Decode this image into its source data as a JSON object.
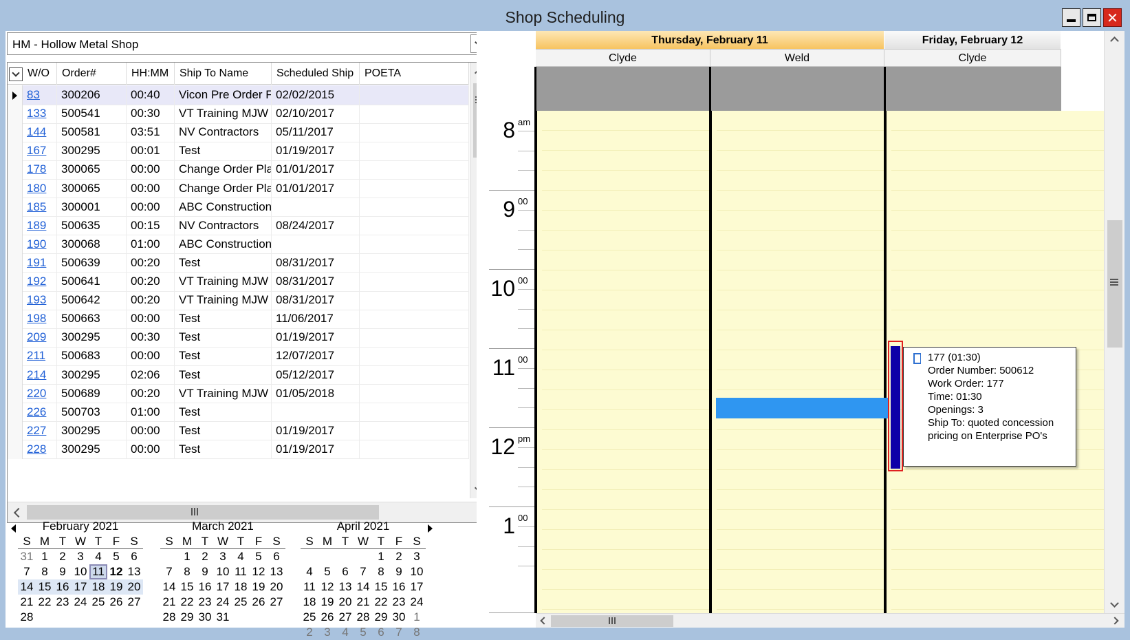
{
  "window": {
    "title": "Shop Scheduling"
  },
  "shop_selector": {
    "value": "HM - Hollow Metal Shop"
  },
  "grid": {
    "columns": [
      "W/O",
      "Order#",
      "HH:MM",
      "Ship To Name",
      "Scheduled Ship",
      "POETA"
    ],
    "rows": [
      {
        "wo": "83",
        "order": "300206",
        "time": "00:40",
        "ship_to": "Vicon Pre Order F",
        "sched": "02/02/2015",
        "poeta": ""
      },
      {
        "wo": "133",
        "order": "500541",
        "time": "00:30",
        "ship_to": "VT Training MJW",
        "sched": "02/10/2017",
        "poeta": ""
      },
      {
        "wo": "144",
        "order": "500581",
        "time": "03:51",
        "ship_to": "NV Contractors",
        "sched": "05/11/2017",
        "poeta": ""
      },
      {
        "wo": "167",
        "order": "300295",
        "time": "00:01",
        "ship_to": "Test",
        "sched": "01/19/2017",
        "poeta": ""
      },
      {
        "wo": "178",
        "order": "300065",
        "time": "00:00",
        "ship_to": "Change Order Pla",
        "sched": "01/01/2017",
        "poeta": ""
      },
      {
        "wo": "180",
        "order": "300065",
        "time": "00:00",
        "ship_to": "Change Order Pla",
        "sched": "01/01/2017",
        "poeta": ""
      },
      {
        "wo": "185",
        "order": "300001",
        "time": "00:00",
        "ship_to": "ABC Construction",
        "sched": "",
        "poeta": ""
      },
      {
        "wo": "189",
        "order": "500635",
        "time": "00:15",
        "ship_to": "NV Contractors",
        "sched": "08/24/2017",
        "poeta": ""
      },
      {
        "wo": "190",
        "order": "300068",
        "time": "01:00",
        "ship_to": "ABC Construction",
        "sched": "",
        "poeta": ""
      },
      {
        "wo": "191",
        "order": "500639",
        "time": "00:20",
        "ship_to": "Test",
        "sched": "08/31/2017",
        "poeta": ""
      },
      {
        "wo": "192",
        "order": "500641",
        "time": "00:20",
        "ship_to": "VT Training MJW",
        "sched": "08/31/2017",
        "poeta": ""
      },
      {
        "wo": "193",
        "order": "500642",
        "time": "00:20",
        "ship_to": "VT Training MJW",
        "sched": "08/31/2017",
        "poeta": ""
      },
      {
        "wo": "198",
        "order": "500663",
        "time": "00:00",
        "ship_to": "Test",
        "sched": "11/06/2017",
        "poeta": ""
      },
      {
        "wo": "209",
        "order": "300295",
        "time": "00:30",
        "ship_to": "Test",
        "sched": "01/19/2017",
        "poeta": ""
      },
      {
        "wo": "211",
        "order": "500683",
        "time": "00:00",
        "ship_to": "Test",
        "sched": "12/07/2017",
        "poeta": ""
      },
      {
        "wo": "214",
        "order": "300295",
        "time": "02:06",
        "ship_to": "Test",
        "sched": "05/12/2017",
        "poeta": ""
      },
      {
        "wo": "220",
        "order": "500689",
        "time": "00:20",
        "ship_to": "VT Training MJW",
        "sched": "01/05/2018",
        "poeta": ""
      },
      {
        "wo": "226",
        "order": "500703",
        "time": "01:00",
        "ship_to": "Test",
        "sched": "",
        "poeta": ""
      },
      {
        "wo": "227",
        "order": "300295",
        "time": "00:00",
        "ship_to": "Test",
        "sched": "01/19/2017",
        "poeta": ""
      },
      {
        "wo": "228",
        "order": "300295",
        "time": "00:00",
        "ship_to": "Test",
        "sched": "01/19/2017",
        "poeta": ""
      }
    ]
  },
  "calendars": [
    {
      "title": "February 2021",
      "dow": [
        "S",
        "M",
        "T",
        "W",
        "T",
        "F",
        "S"
      ],
      "weeks": [
        [
          "31",
          "1",
          "2",
          "3",
          "4",
          "5",
          "6"
        ],
        [
          "7",
          "8",
          "9",
          "10",
          "11",
          "12",
          "13"
        ],
        [
          "14",
          "15",
          "16",
          "17",
          "18",
          "19",
          "20"
        ],
        [
          "21",
          "22",
          "23",
          "24",
          "25",
          "26",
          "27"
        ],
        [
          "28"
        ]
      ]
    },
    {
      "title": "March 2021",
      "dow": [
        "S",
        "M",
        "T",
        "W",
        "T",
        "F",
        "S"
      ],
      "weeks": [
        [
          "",
          "1",
          "2",
          "3",
          "4",
          "5",
          "6"
        ],
        [
          "7",
          "8",
          "9",
          "10",
          "11",
          "12",
          "13"
        ],
        [
          "14",
          "15",
          "16",
          "17",
          "18",
          "19",
          "20"
        ],
        [
          "21",
          "22",
          "23",
          "24",
          "25",
          "26",
          "27"
        ],
        [
          "28",
          "29",
          "30",
          "31"
        ]
      ]
    },
    {
      "title": "April 2021",
      "dow": [
        "S",
        "M",
        "T",
        "W",
        "T",
        "F",
        "S"
      ],
      "weeks": [
        [
          "",
          "",
          "",
          "",
          "1",
          "2",
          "3"
        ],
        [
          "4",
          "5",
          "6",
          "7",
          "8",
          "9",
          "10"
        ],
        [
          "11",
          "12",
          "13",
          "14",
          "15",
          "16",
          "17"
        ],
        [
          "18",
          "19",
          "20",
          "21",
          "22",
          "23",
          "24"
        ],
        [
          "25",
          "26",
          "27",
          "28",
          "29",
          "30",
          "1"
        ],
        [
          "2",
          "3",
          "4",
          "5",
          "6",
          "7",
          "8"
        ]
      ]
    }
  ],
  "scheduler": {
    "days": [
      {
        "label": "Thursday, February 11",
        "resources": [
          "Clyde",
          "Weld"
        ]
      },
      {
        "label": "Friday, February 12",
        "resources": [
          "Clyde"
        ]
      }
    ],
    "hours": [
      {
        "num": "8",
        "sub": "am"
      },
      {
        "num": "9",
        "sub": "00"
      },
      {
        "num": "10",
        "sub": "00"
      },
      {
        "num": "11",
        "sub": "00"
      },
      {
        "num": "12",
        "sub": "pm"
      },
      {
        "num": "1",
        "sub": "00"
      }
    ],
    "tooltip": {
      "lines": [
        "177 (01:30)",
        "Order Number: 500612",
        "Work Order: 177",
        "Time: 01:30",
        "Openings: 3",
        "Ship To: quoted concession",
        "pricing on Enterprise PO's"
      ]
    },
    "colors": {
      "appointment": "#2f96f1",
      "status_bar": "#0d00a8",
      "highlight": "#e02020",
      "work_area": "#fdfbd2"
    }
  }
}
